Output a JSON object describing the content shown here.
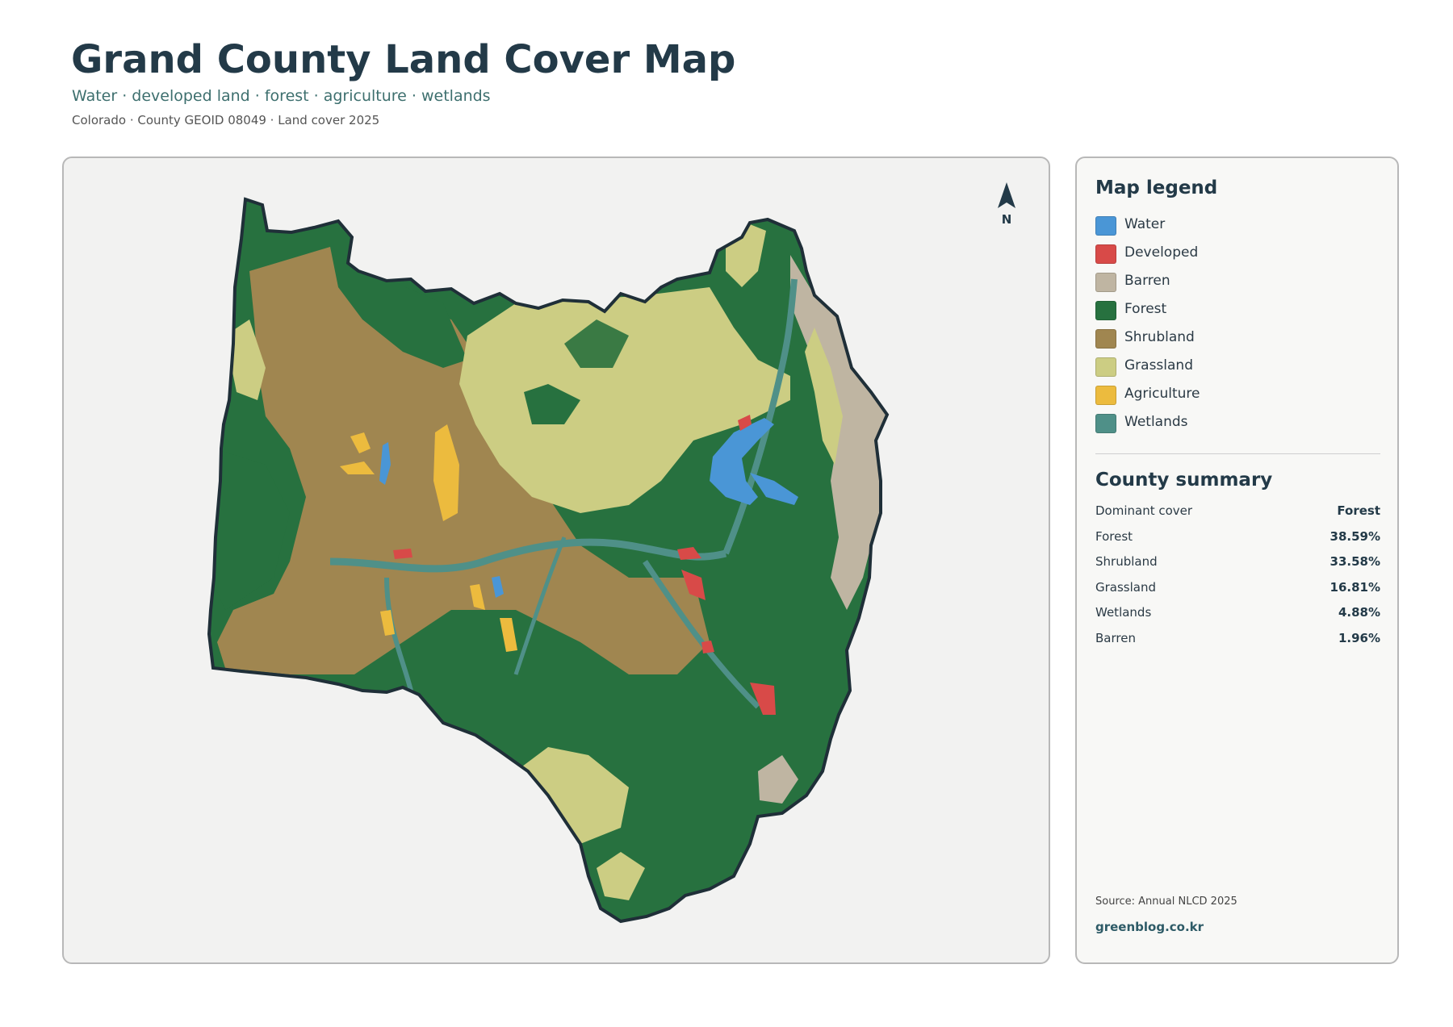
{
  "header": {
    "title": "Grand County Land Cover Map",
    "subtitle": "Water · developed land · forest · agriculture · wetlands",
    "meta": "Colorado · County GEOID 08049 · Land cover 2025"
  },
  "map": {
    "north_label": "N",
    "north_icon": "north-arrow-icon",
    "colors": {
      "water": "#4a96d6",
      "developed": "#d84a48",
      "barren": "#bfb5a2",
      "forest": "#27713f",
      "shrubland": "#a08650",
      "grassland": "#cccd83",
      "agriculture": "#ecbb3e",
      "wetlands": "#4f9088",
      "outline": "#1f2f38"
    }
  },
  "legend": {
    "title": "Map legend",
    "items": [
      {
        "label": "Water",
        "color": "#4a96d6"
      },
      {
        "label": "Developed",
        "color": "#d84a48"
      },
      {
        "label": "Barren",
        "color": "#bfb5a2"
      },
      {
        "label": "Forest",
        "color": "#27713f"
      },
      {
        "label": "Shrubland",
        "color": "#a08650"
      },
      {
        "label": "Grassland",
        "color": "#cccd83"
      },
      {
        "label": "Agriculture",
        "color": "#ecbb3e"
      },
      {
        "label": "Wetlands",
        "color": "#4f9088"
      }
    ]
  },
  "summary": {
    "title": "County summary",
    "rows": [
      {
        "label": "Dominant cover",
        "value": "Forest"
      },
      {
        "label": "Forest",
        "value": "38.59%"
      },
      {
        "label": "Shrubland",
        "value": "33.58%"
      },
      {
        "label": "Grassland",
        "value": "16.81%"
      },
      {
        "label": "Wetlands",
        "value": "4.88%"
      },
      {
        "label": "Barren",
        "value": "1.96%"
      }
    ]
  },
  "footer": {
    "source": "Source: Annual NLCD 2025",
    "brand": "greenblog.co.kr"
  }
}
